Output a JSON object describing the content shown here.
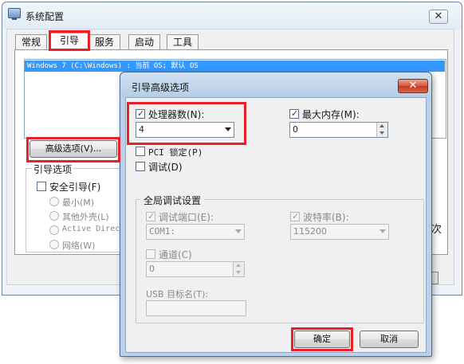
{
  "back_window": {
    "title": "系统配置",
    "close_glyph": "✕",
    "tabs": [
      "常规",
      "引导",
      "服务",
      "启动",
      "工具"
    ],
    "active_tab": "引导",
    "boot_entry": "Windows 7 (C:\\Windows) : 当前 OS; 默认 OS",
    "advanced_button": "高级选项(V)...",
    "boot_options": {
      "label": "引导选项",
      "safe_boot": "安全引导(F)",
      "radios": [
        "最小(M)",
        "其他外壳(L)",
        "Active Direc",
        "网络(W)"
      ]
    },
    "partial_right_text": "次"
  },
  "dialog": {
    "title": "引导高级选项",
    "close_glyph": "✕",
    "processor_count_label": "处理器数(N):",
    "processor_count_value": "4",
    "max_memory_label": "最大内存(M):",
    "max_memory_value": "0",
    "pci_lock_label": "PCI 锁定(P)",
    "debug_label": "调试(D)",
    "global_debug": {
      "label": "全局调试设置",
      "debug_port_label": "调试端口(E):",
      "debug_port_value": "COM1:",
      "baud_rate_label": "波特率(B):",
      "baud_rate_value": "115200",
      "channel_label": "通道(C)",
      "channel_value": "0",
      "usb_target_label": "USB 目标名(T):",
      "usb_target_value": ""
    },
    "ok_button": "确定",
    "cancel_button": "取消"
  },
  "colors": {
    "highlight": "#e8202a",
    "selection": "#3399ff",
    "dialog_frame": "#b9d1ea",
    "close_button": "#c13a22"
  }
}
